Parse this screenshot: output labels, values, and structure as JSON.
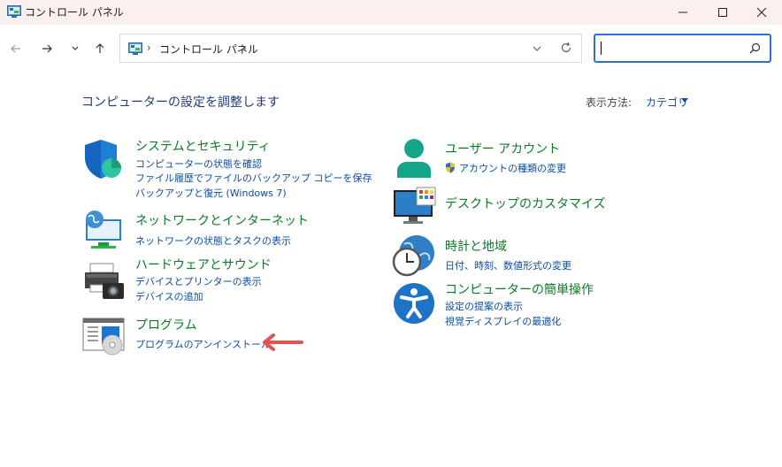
{
  "window": {
    "title": "コントロール パネル"
  },
  "address_bar": {
    "path": "コントロール パネル",
    "separator": "›"
  },
  "search": {
    "placeholder": ""
  },
  "main": {
    "title": "コンピューターの設定を調整します",
    "view_by_label": "表示方法:",
    "view_by_value": "カテゴリ"
  },
  "categories": {
    "security": {
      "title": "システムとセキュリティ",
      "links": [
        "コンピューターの状態を確認",
        "ファイル履歴でファイルのバックアップ コピーを保存",
        "バックアップと復元 (Windows 7)"
      ]
    },
    "network": {
      "title": "ネットワークとインターネット",
      "links": [
        "ネットワークの状態とタスクの表示"
      ]
    },
    "hardware": {
      "title": "ハードウェアとサウンド",
      "links": [
        "デバイスとプリンターの表示",
        "デバイスの追加"
      ]
    },
    "programs": {
      "title": "プログラム",
      "links": [
        "プログラムのアンインストール"
      ]
    },
    "accounts": {
      "title": "ユーザー アカウント",
      "links": [
        "アカウントの種類の変更"
      ]
    },
    "desktop": {
      "title": "デスクトップのカスタマイズ",
      "links": []
    },
    "clock": {
      "title": "時計と地域",
      "links": [
        "日付、時刻、数値形式の変更"
      ]
    },
    "ease": {
      "title": "コンピューターの簡単操作",
      "links": [
        "設定の提案の表示",
        "視覚ディスプレイの最適化"
      ]
    }
  },
  "colors": {
    "category_title": "#0b7a25",
    "link": "#0b4da2",
    "page_title": "#1e3c78",
    "arrow": "#e8504f",
    "search_border": "#2f6fd0"
  }
}
